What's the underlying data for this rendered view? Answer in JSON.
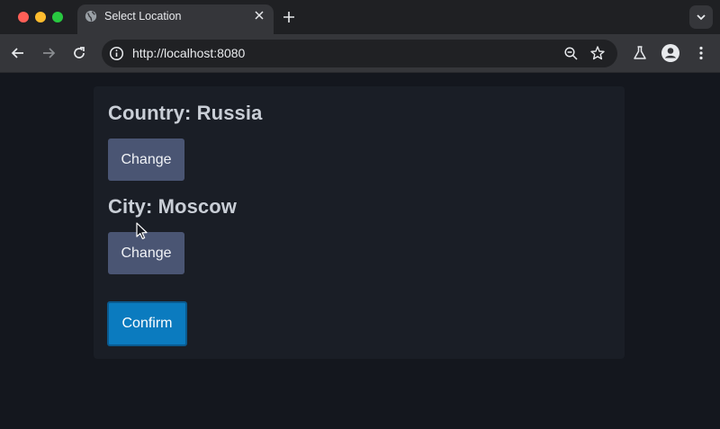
{
  "browser": {
    "tab_title": "Select Location",
    "url": "http://localhost:8080"
  },
  "page": {
    "country_heading": "Country: Russia",
    "city_heading": "City: Moscow",
    "change_country_label": "Change",
    "change_city_label": "Change",
    "confirm_label": "Confirm"
  },
  "colors": {
    "change_button": "#4a5573",
    "confirm_button": "#0b7bbf",
    "heading_text": "#c9ced6",
    "page_bg": "#14171e",
    "card_bg": "#1a1e26"
  },
  "icons": [
    "globe-icon",
    "close-icon",
    "plus-icon",
    "chevron-down-icon",
    "back-arrow-icon",
    "forward-arrow-icon",
    "reload-icon",
    "info-icon",
    "zoom-icon",
    "star-icon",
    "flask-icon",
    "profile-icon",
    "kebab-menu-icon",
    "mouse-cursor-icon"
  ]
}
